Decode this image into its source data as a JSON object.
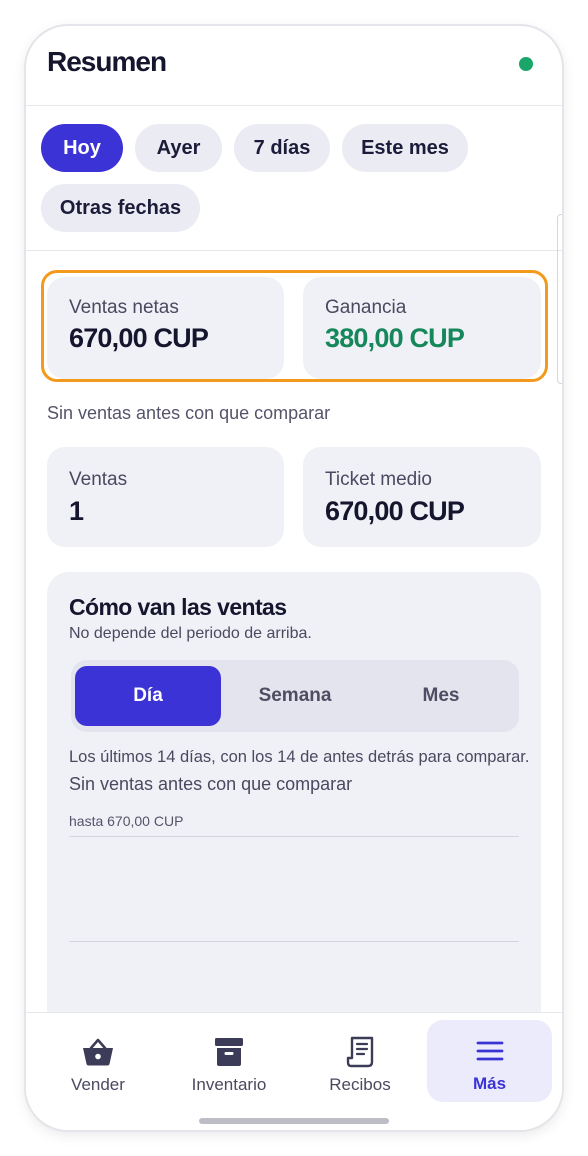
{
  "header": {
    "title": "Resumen",
    "status_color": "#1aa56b"
  },
  "filters": {
    "chips": [
      {
        "label": "Hoy",
        "active": true
      },
      {
        "label": "Ayer",
        "active": false
      },
      {
        "label": "7 días",
        "active": false
      },
      {
        "label": "Este mes",
        "active": false
      },
      {
        "label": "Otras fechas",
        "active": false
      }
    ]
  },
  "metrics": {
    "net_sales": {
      "label": "Ventas netas",
      "value": "670,00 CUP"
    },
    "profit": {
      "label": "Ganancia",
      "value": "380,00 CUP"
    },
    "no_compare": "Sin ventas antes con que comparar",
    "sales_count": {
      "label": "Ventas",
      "value": "1"
    },
    "avg_ticket": {
      "label": "Ticket medio",
      "value": "670,00 CUP"
    }
  },
  "sales_trend": {
    "title": "Cómo van las ventas",
    "subtitle": "No depende del periodo de arriba.",
    "segments": [
      {
        "label": "Día",
        "active": true
      },
      {
        "label": "Semana",
        "active": false
      },
      {
        "label": "Mes",
        "active": false
      }
    ],
    "note": "Los últimos 14 días, con los 14 de antes detrás para comparar.",
    "note2": "Sin ventas antes con que comparar",
    "axis_label": "hasta 670,00 CUP"
  },
  "nav": {
    "items": [
      {
        "label": "Vender",
        "icon": "basket-icon"
      },
      {
        "label": "Inventario",
        "icon": "archive-box-icon"
      },
      {
        "label": "Recibos",
        "icon": "receipt-icon"
      },
      {
        "label": "Más",
        "icon": "menu-icon",
        "active": true
      }
    ]
  },
  "colors": {
    "accent": "#3b33d6",
    "highlight_border": "#f39a1d",
    "profit_green": "#16875a"
  }
}
